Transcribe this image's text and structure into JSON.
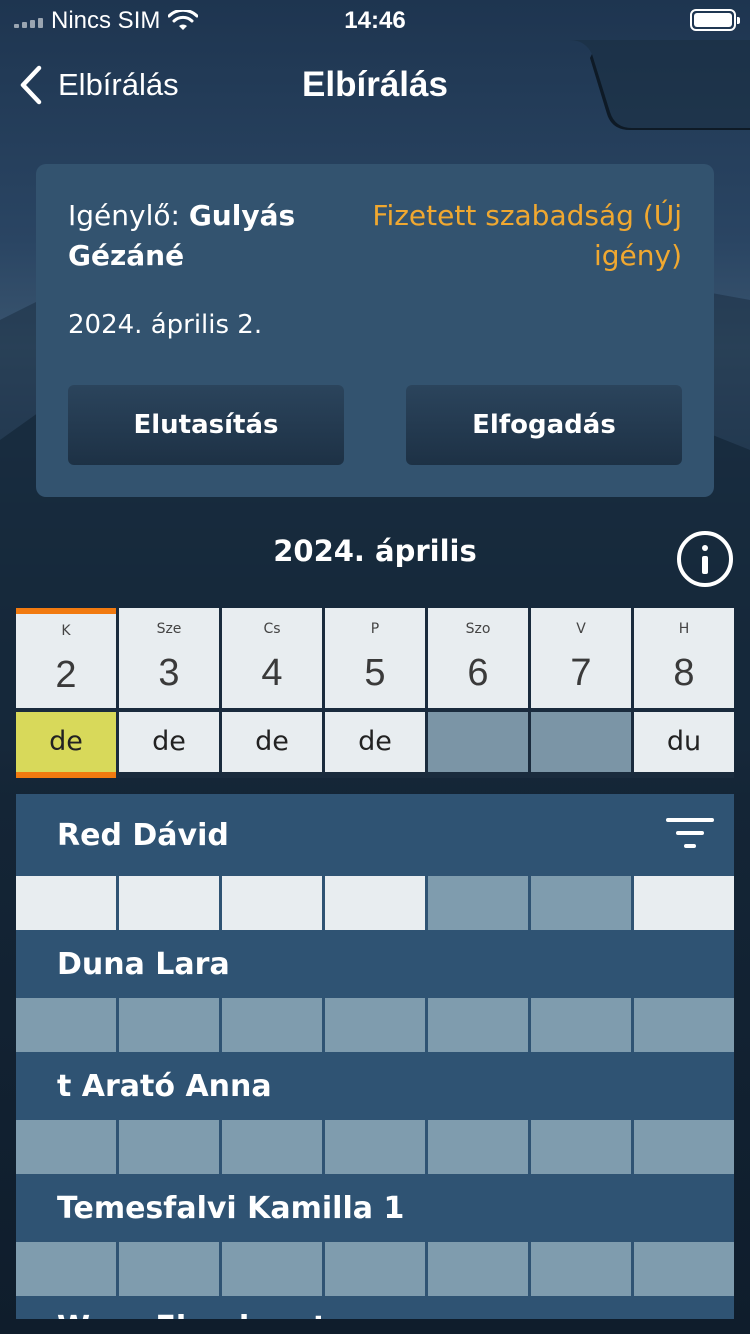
{
  "status_bar": {
    "carrier": "Nincs SIM",
    "time": "14:46"
  },
  "nav": {
    "back_label": "Elbírálás",
    "title": "Elbírálás"
  },
  "request": {
    "applicant_label": "Igénylő: ",
    "applicant_name": "Gulyás Gézáné",
    "type": "Fizetett szabadság (Új igény)",
    "date": "2024. április 2.",
    "reject_label": "Elutasítás",
    "accept_label": "Elfogadás"
  },
  "calendar": {
    "month": "2024. április",
    "days": [
      {
        "name": "K",
        "date": "2",
        "half": "de",
        "state": "selected"
      },
      {
        "name": "Sze",
        "date": "3",
        "half": "de",
        "state": "normal"
      },
      {
        "name": "Cs",
        "date": "4",
        "half": "de",
        "state": "normal"
      },
      {
        "name": "P",
        "date": "5",
        "half": "de",
        "state": "normal"
      },
      {
        "name": "Szo",
        "date": "6",
        "half": "",
        "state": "empty"
      },
      {
        "name": "V",
        "date": "7",
        "half": "",
        "state": "empty"
      },
      {
        "name": "H",
        "date": "8",
        "half": "du",
        "state": "normal"
      }
    ]
  },
  "staff": [
    {
      "name": "Red Dávid",
      "cells": [
        "light",
        "light",
        "light",
        "light",
        "dark",
        "dark",
        "light"
      ]
    },
    {
      "name": "Duna Lara",
      "cells": [
        "dark",
        "dark",
        "dark",
        "dark",
        "dark",
        "dark",
        "dark"
      ]
    },
    {
      "name": "t Arató Anna",
      "cells": [
        "dark",
        "dark",
        "dark",
        "dark",
        "dark",
        "dark",
        "dark"
      ]
    },
    {
      "name": "Temesfalvi Kamilla 1",
      "cells": [
        "dark",
        "dark",
        "dark",
        "dark",
        "dark",
        "dark",
        "dark"
      ]
    },
    {
      "name": "Wass Flanders t",
      "cells": [
        "dark",
        "dark",
        "dark",
        "dark",
        "dark",
        "dark",
        "dark"
      ]
    }
  ],
  "colors": {
    "accent_orange": "#f0a830",
    "today_marker": "#f17a10",
    "selected_half": "#d8d95a"
  }
}
